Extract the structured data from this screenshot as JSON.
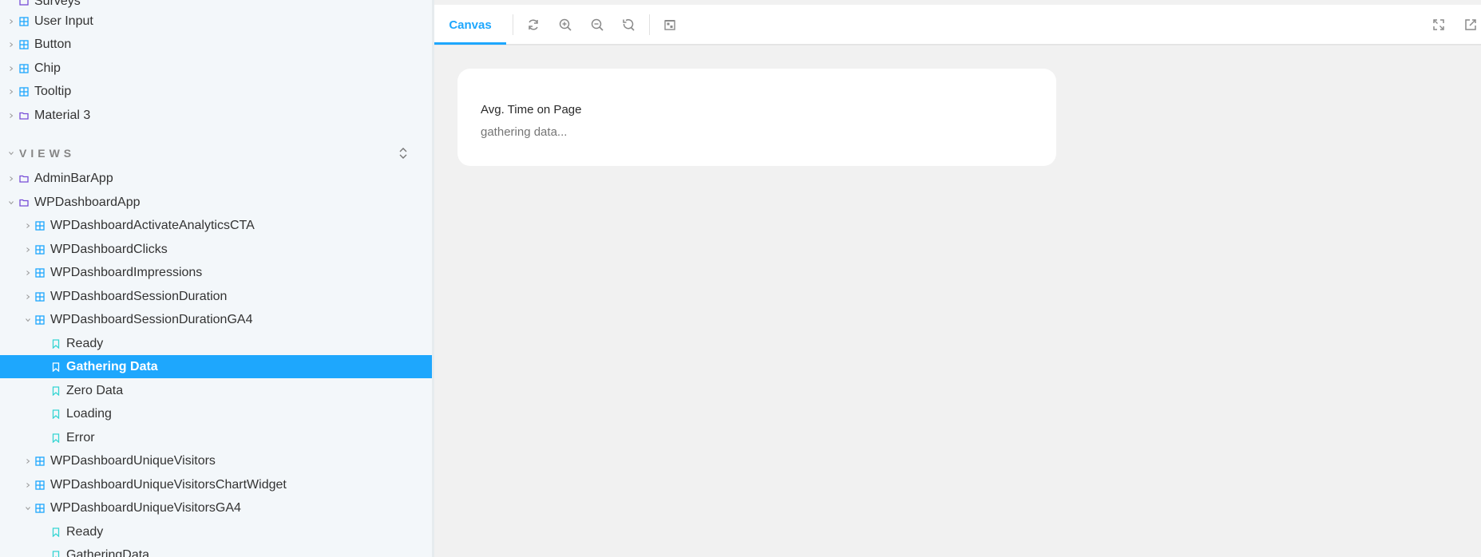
{
  "sidebar": {
    "top_items": [
      {
        "label": "Surveys",
        "kind": "folder-partial"
      },
      {
        "label": "User Input",
        "kind": "component"
      },
      {
        "label": "Button",
        "kind": "component"
      },
      {
        "label": "Chip",
        "kind": "component"
      },
      {
        "label": "Tooltip",
        "kind": "component"
      },
      {
        "label": "Material 3",
        "kind": "folder"
      }
    ],
    "views_section_title": "VIEWS",
    "views_items": [
      {
        "label": "AdminBarApp",
        "kind": "folder",
        "depth": 0
      },
      {
        "label": "WPDashboardApp",
        "kind": "folder",
        "depth": 0,
        "expanded": true
      },
      {
        "label": "WPDashboardActivateAnalyticsCTA",
        "kind": "component",
        "depth": 1
      },
      {
        "label": "WPDashboardClicks",
        "kind": "component",
        "depth": 1
      },
      {
        "label": "WPDashboardImpressions",
        "kind": "component",
        "depth": 1
      },
      {
        "label": "WPDashboardSessionDuration",
        "kind": "component",
        "depth": 1
      },
      {
        "label": "WPDashboardSessionDurationGA4",
        "kind": "component",
        "depth": 1,
        "expanded": true
      },
      {
        "label": "Ready",
        "kind": "story",
        "depth": 2
      },
      {
        "label": "Gathering Data",
        "kind": "story",
        "depth": 2,
        "selected": true
      },
      {
        "label": "Zero Data",
        "kind": "story",
        "depth": 2
      },
      {
        "label": "Loading",
        "kind": "story",
        "depth": 2
      },
      {
        "label": "Error",
        "kind": "story",
        "depth": 2
      },
      {
        "label": "WPDashboardUniqueVisitors",
        "kind": "component",
        "depth": 1
      },
      {
        "label": "WPDashboardUniqueVisitorsChartWidget",
        "kind": "component",
        "depth": 1
      },
      {
        "label": "WPDashboardUniqueVisitorsGA4",
        "kind": "component",
        "depth": 1,
        "expanded": true
      },
      {
        "label": "Ready",
        "kind": "story",
        "depth": 2
      },
      {
        "label": "GatheringData",
        "kind": "story",
        "depth": 2
      }
    ]
  },
  "toolbar": {
    "canvas_tab": "Canvas",
    "buttons": [
      "reload-icon",
      "zoom-in-icon",
      "zoom-out-icon",
      "reset-zoom-icon",
      "background-icon",
      "fullscreen-icon",
      "open-new-tab-icon"
    ]
  },
  "card": {
    "title": "Avg. Time on Page",
    "status": "gathering data..."
  },
  "colors": {
    "accent": "#1ea7fd",
    "sidebar_bg": "#f3f7fa",
    "canvas_bg": "#f1f1f1",
    "folder_icon": "#774dd7",
    "component_icon": "#1ea7fd",
    "story_icon": "#37d5d3"
  }
}
